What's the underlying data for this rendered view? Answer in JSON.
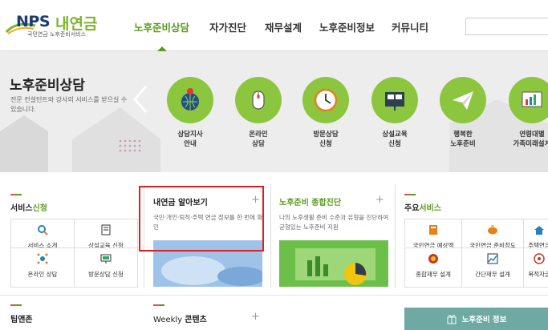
{
  "header": {
    "logo": {
      "brand": "NPS",
      "name": "내연금",
      "tagline": "국민연금 노후준비서비스"
    },
    "nav": [
      "노후준비상담",
      "자가진단",
      "재무설계",
      "노후준비정보",
      "커뮤니티"
    ],
    "active_nav": "노후준비상담"
  },
  "banner": {
    "title": "노후준비상담",
    "description": "전문 컨설턴트와 강사의 서비스를 받으실 수 있습니다.",
    "items": [
      {
        "label": "상담지사\n안내",
        "icon": "globe-pin-icon"
      },
      {
        "label": "온라인\n상담",
        "icon": "computer-mouse-icon"
      },
      {
        "label": "방문상담\n신청",
        "icon": "clock-icon"
      },
      {
        "label": "상설교육\n신청",
        "icon": "presentation-board-icon"
      },
      {
        "label": "행복한\n노후준비",
        "icon": "paper-plane-icon"
      },
      {
        "label": "연령대별\n가족미래설계",
        "icon": "chart-board-icon"
      }
    ]
  },
  "service_apply": {
    "title_prefix": "서비스",
    "title_suffix": "신청",
    "items": [
      {
        "label": "서비스 소개",
        "icon": "magnifier-icon"
      },
      {
        "label": "상설교육 신청",
        "icon": "book-icon"
      },
      {
        "label": "온라인 상담",
        "icon": "network-icon"
      },
      {
        "label": "방문상담 신청",
        "icon": "monitor-icon"
      }
    ]
  },
  "pension_info": {
    "title": "내연금 알아보기",
    "plus": "+",
    "description": "국민·개인·퇴직·주택 연금 정보를 한 번에 확인"
  },
  "diagnosis": {
    "title": "노후준비 종합진단",
    "plus": "+",
    "description": "나의 노후생활 준비 수준과 유형을 진단하여 균형있는 노후준비 지원"
  },
  "main_services": {
    "title_prefix": "주요",
    "title_suffix": "서비스",
    "items": [
      {
        "label": "국민연금 예상액",
        "icon": "calculator-icon"
      },
      {
        "label": "국민연금 준비정도",
        "icon": "piggy-bank-icon"
      },
      {
        "label": "주택연금",
        "icon": "house-icon"
      },
      {
        "label": "종합재무 설계",
        "icon": "coin-icon"
      },
      {
        "label": "간단재무 설계",
        "icon": "chart-icon"
      },
      {
        "label": "목적자금",
        "icon": "target-icon"
      }
    ]
  },
  "bottom": {
    "tips_title": "팁앤존",
    "weekly_prefix": "Weekly ",
    "weekly_suffix": "콘텐츠",
    "weekly_plus": "+",
    "info_button": "노후준비 정보"
  }
}
